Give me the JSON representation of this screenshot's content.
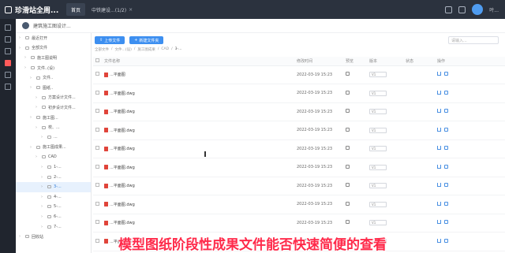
{
  "app": {
    "title": "珍滑站全周..."
  },
  "topnav": {
    "items": [
      {
        "label": "首页"
      },
      {
        "label": "中铁建设...(1/2)"
      }
    ]
  },
  "user": {
    "name": "叶..."
  },
  "project": {
    "name": "建筑施工图设计..."
  },
  "tree": {
    "nodes": [
      {
        "label": "最近打开",
        "indent": 0
      },
      {
        "label": "全部文件",
        "indent": 0
      },
      {
        "label": "施工图说明",
        "indent": 1
      },
      {
        "label": "文件..(设)",
        "indent": 1
      },
      {
        "label": "文件..",
        "indent": 2
      },
      {
        "label": "图纸..",
        "indent": 2
      },
      {
        "label": "方案设计文件...",
        "indent": 3
      },
      {
        "label": "初步设计文件...",
        "indent": 3
      },
      {
        "label": "施工图...",
        "indent": 2
      },
      {
        "label": "校、...",
        "indent": 3
      },
      {
        "label": "...",
        "indent": 4
      },
      {
        "label": "施工图成果...",
        "indent": 2
      },
      {
        "label": "CAD",
        "indent": 3
      },
      {
        "label": "1-...",
        "indent": 4
      },
      {
        "label": "2-...",
        "indent": 4
      },
      {
        "label": "3-...",
        "indent": 4
      },
      {
        "label": "4-...",
        "indent": 4
      },
      {
        "label": "5-...",
        "indent": 4
      },
      {
        "label": "6-...",
        "indent": 4
      },
      {
        "label": "7-...",
        "indent": 4
      },
      {
        "label": "回收站",
        "indent": 0
      }
    ],
    "selected_index": 15
  },
  "toolbar": {
    "upload_label": "上传文件",
    "new_folder_label": "新建文件夹"
  },
  "search": {
    "placeholder": "请输入..."
  },
  "breadcrumb": {
    "items": [
      "全部文件",
      "文件...(设)",
      "施工图成果",
      "CAD",
      "3-..."
    ]
  },
  "table": {
    "headers": [
      "",
      "文件名称",
      "修改时间",
      "预览",
      "版本",
      "状态",
      "操作"
    ],
    "rows": [
      {
        "name": "...平面图",
        "time": "2022-03-19 15:23",
        "version": "V1"
      },
      {
        "name": "...平面图.dwg",
        "time": "2022-03-19 15:23",
        "version": "V1"
      },
      {
        "name": "...平面图.dwg",
        "time": "2022-03-19 15:23",
        "version": "V1"
      },
      {
        "name": "...平面图.dwg",
        "time": "2022-03-19 15:23",
        "version": "V1"
      },
      {
        "name": "...平面图.dwg",
        "time": "2022-03-19 15:23",
        "version": "V1"
      },
      {
        "name": "...平面图.dwg",
        "time": "2022-03-19 15:23",
        "version": "V1"
      },
      {
        "name": "...平面图.dwg",
        "time": "2022-03-19 15:23",
        "version": "V1"
      },
      {
        "name": "...平面图.dwg",
        "time": "2022-03-19 15:23",
        "version": "V1"
      },
      {
        "name": "...平面图.dwg",
        "time": "2022-03-19 15:23",
        "version": "V1"
      },
      {
        "name": "...平面图.dwg",
        "time": "2022-03-19 15:23",
        "version": "V1"
      }
    ]
  },
  "caption": {
    "text": "模型图纸阶段性成果文件能否快速简便的查看"
  }
}
